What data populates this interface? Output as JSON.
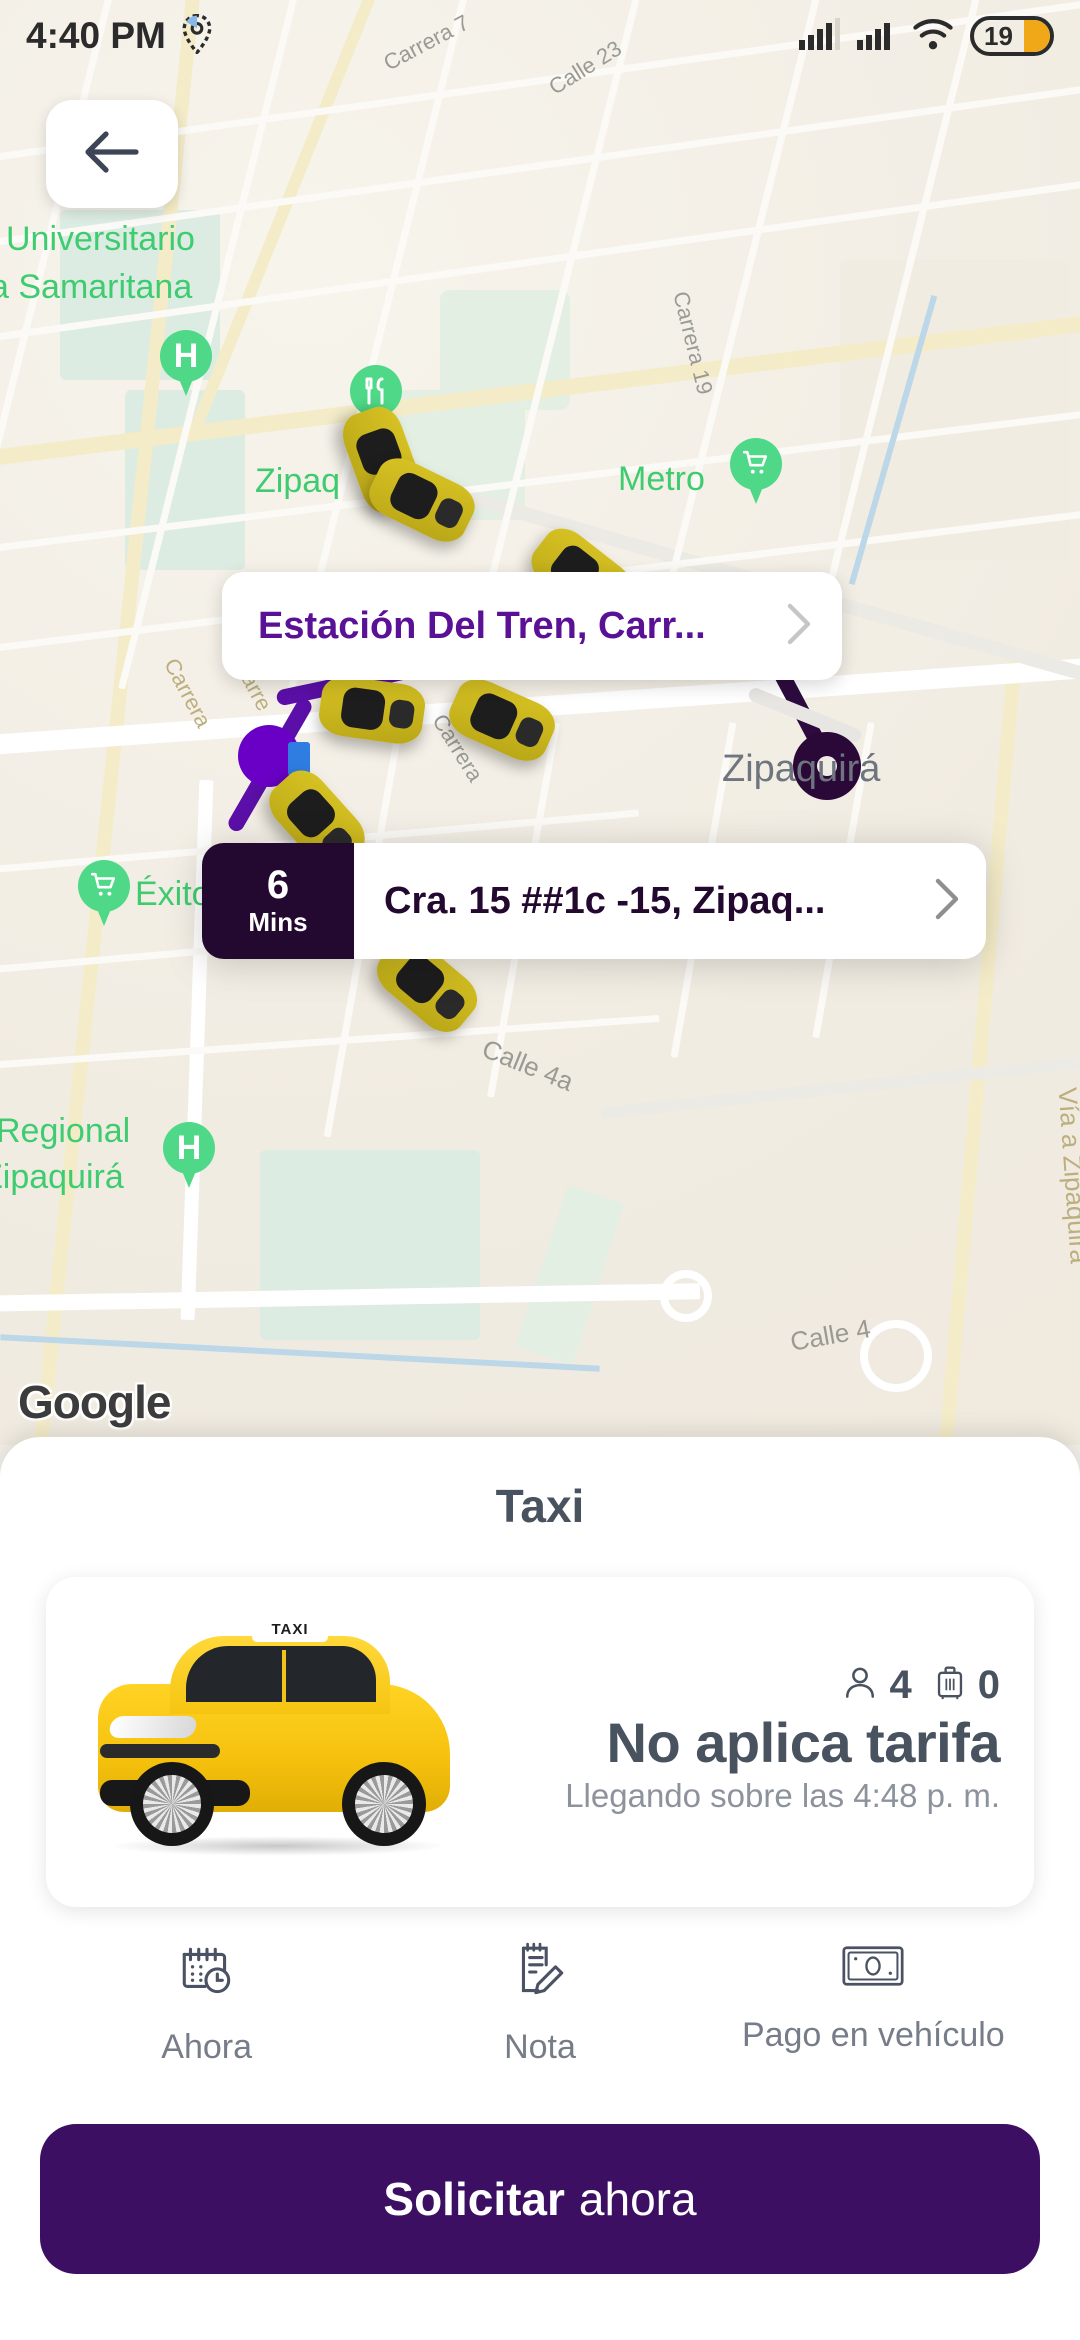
{
  "status_bar": {
    "time": "4:40 PM",
    "location_icon": "location-pin-icon",
    "signal_icon_1": "cellular-signal-icon",
    "signal_icon_2": "cellular-signal-icon",
    "wifi_icon": "wifi-icon",
    "battery_level": "19"
  },
  "map": {
    "back_icon": "back-arrow-icon",
    "attribution": "Google",
    "pois": [
      {
        "label": "Universitario",
        "icon": "hospital-pin-icon"
      },
      {
        "label": "a Samaritana",
        "icon": "hospital-pin-icon"
      },
      {
        "label": "Zipaq",
        "icon": "restaurant-pin-icon"
      },
      {
        "label": "Metro",
        "icon": "shopping-cart-pin-icon"
      },
      {
        "label": "Éxito",
        "icon": "shopping-cart-pin-icon"
      },
      {
        "label": "Regional",
        "icon": "hospital-pin-icon"
      },
      {
        "label": "Zipaquirá",
        "icon": "hospital-pin-icon"
      }
    ],
    "city_label": "Zipaquirá",
    "streets": [
      "Carrera 7",
      "Calle 23",
      "Carrera 19",
      "Carrera",
      "Carre",
      "Carrera",
      "Calle 4a",
      "Calle 4",
      "Vía a Zipaquira"
    ]
  },
  "route": {
    "origin": {
      "address": "Estación Del Tren, Carr...",
      "chevron_icon": "chevron-right-icon",
      "marker_color": "#6a00c6"
    },
    "destination": {
      "address": "Cra. 15 ##1c -15, Zipaq...",
      "chevron_icon": "chevron-right-icon",
      "marker_color": "#2a0838"
    },
    "eta": {
      "value": "6",
      "unit": "Mins"
    }
  },
  "sheet": {
    "title": "Taxi",
    "vehicle": {
      "image_name": "yellow-taxi-illustration",
      "taxi_sign_text": "TAXI",
      "passenger_icon": "passenger-icon",
      "passenger_capacity": "4",
      "luggage_icon": "luggage-icon",
      "luggage_capacity": "0",
      "fare": "No aplica tarifa",
      "arrival": "Llegando sobre las 4:48 p. m."
    },
    "options": [
      {
        "label": "Ahora",
        "icon": "calendar-clock-icon"
      },
      {
        "label": "Nota",
        "icon": "note-pencil-icon"
      },
      {
        "label": "Pago en vehículo",
        "icon": "banknote-icon"
      }
    ],
    "cta": {
      "bold_label": "Solicitar",
      "light_label": "ahora",
      "color": "#3c0f63"
    }
  }
}
